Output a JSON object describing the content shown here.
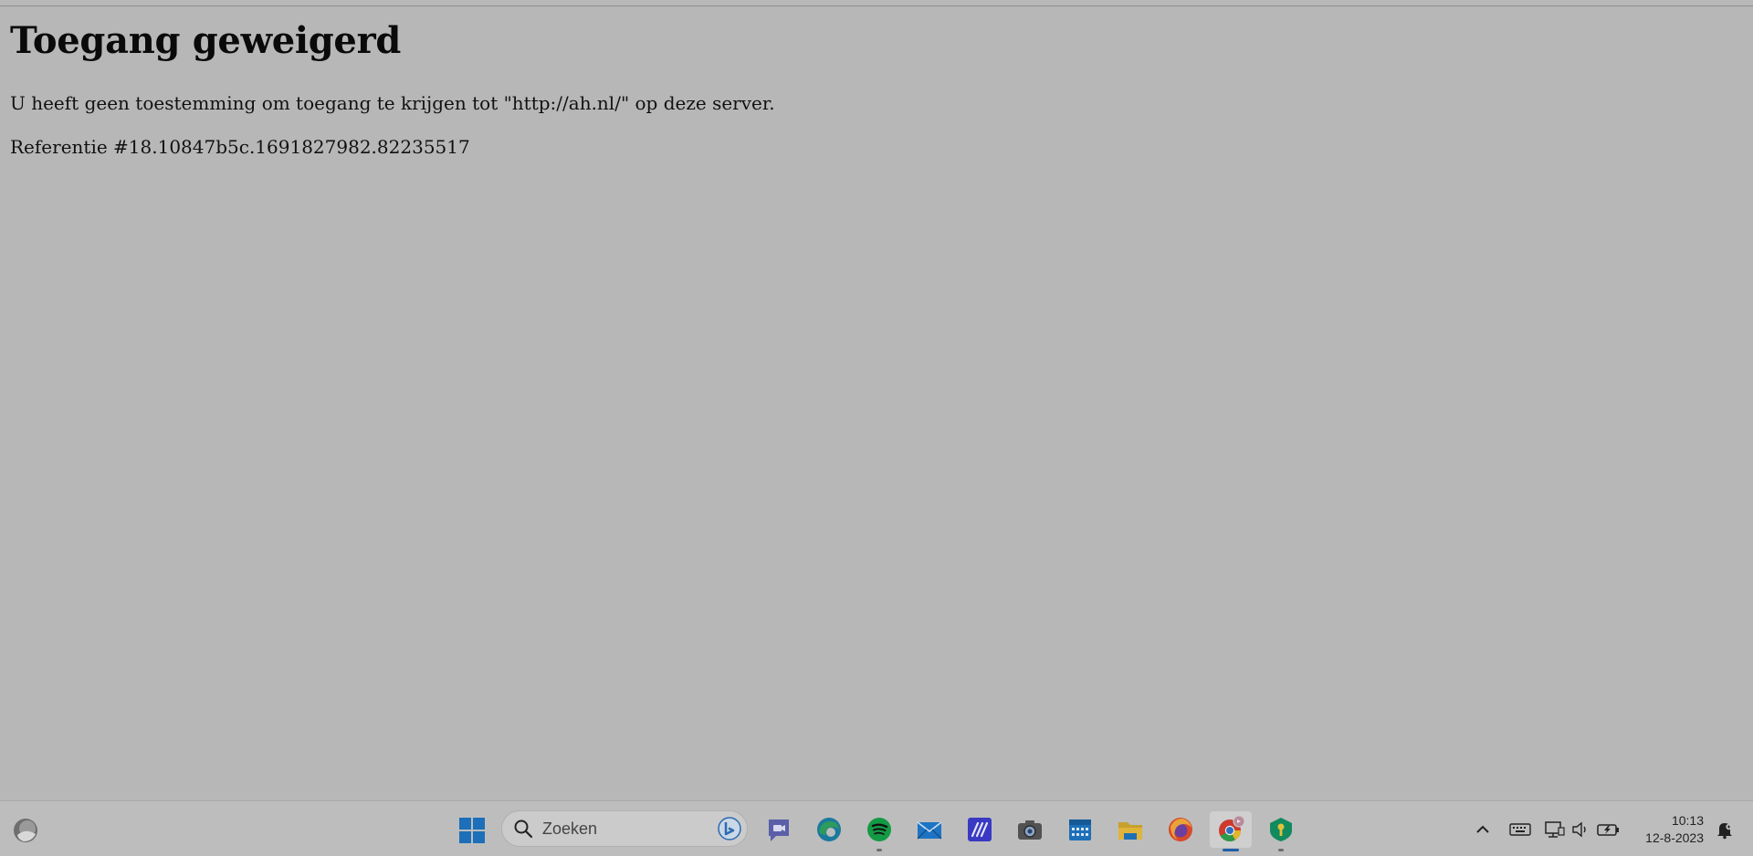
{
  "page": {
    "heading": "Toegang geweigerd",
    "message": "U heeft geen toestemming om toegang te krijgen tot \"http://ah.nl/\" op deze server.",
    "reference": "Referentie #18.10847b5c.1691827982.82235517"
  },
  "taskbar": {
    "search_placeholder": "Zoeken",
    "apps": [
      {
        "name": "start",
        "icon": "windows-start-icon"
      },
      {
        "name": "teams",
        "icon": "video-chat-icon"
      },
      {
        "name": "edge",
        "icon": "edge-browser-icon"
      },
      {
        "name": "spotify",
        "icon": "spotify-icon"
      },
      {
        "name": "mail",
        "icon": "mail-icon"
      },
      {
        "name": "app",
        "icon": "stripes-app-icon"
      },
      {
        "name": "camera",
        "icon": "camera-icon"
      },
      {
        "name": "calendar",
        "icon": "calendar-icon"
      },
      {
        "name": "files",
        "icon": "folder-icon"
      },
      {
        "name": "firefox",
        "icon": "firefox-icon"
      },
      {
        "name": "chrome",
        "icon": "chrome-icon"
      },
      {
        "name": "keepass",
        "icon": "key-shield-icon"
      }
    ],
    "clock": {
      "time": "10:13",
      "date": "12-8-2023"
    }
  },
  "colors": {
    "page_bg": "#b7b7b7",
    "taskbar_bg": "#bdbdbd",
    "active_indicator": "#1f5fa8"
  }
}
